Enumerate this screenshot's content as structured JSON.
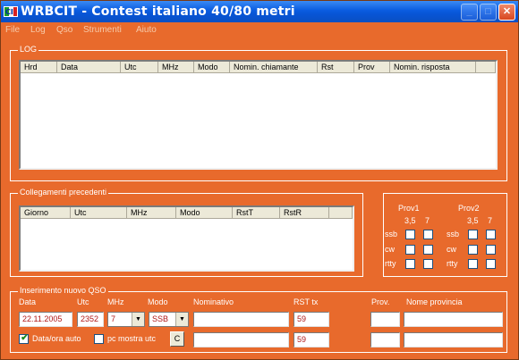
{
  "window": {
    "title": "WRBCIT - Contest italiano 40/80 metri",
    "minimize": "_",
    "maximize": "□",
    "close": "✕",
    "icon": "app-icon"
  },
  "menu": [
    "File",
    "Log",
    "Qso",
    "Strumenti",
    "Aiuto"
  ],
  "log": {
    "label": "LOG",
    "columns": [
      "Hrd",
      "Data",
      "Utc",
      "MHz",
      "Modo",
      "Nomin. chiamante",
      "Rst",
      "Prov",
      "Nomin. risposta"
    ]
  },
  "previous": {
    "label": "Collegamenti precedenti",
    "columns": [
      "Giorno",
      "Utc",
      "MHz",
      "Modo",
      "RstT",
      "RstR"
    ]
  },
  "prov": {
    "prov1": "Prov1",
    "prov2": "Prov2",
    "band1": "3,5",
    "band2": "7",
    "modes": [
      "ssb",
      "cw",
      "rtty"
    ]
  },
  "newqso": {
    "label": "Inserimento nuovo QSO",
    "data_label": "Data",
    "utc_label": "Utc",
    "mhz_label": "MHz",
    "modo_label": "Modo",
    "nominativo_label": "Nominativo",
    "rst_label": "RST tx",
    "prov_label": "Prov.",
    "nome_prov_label": "Nome provincia",
    "data_value": "22.11.2005",
    "utc_value": "2352",
    "mhz_value": "7",
    "modo_value": "SSB",
    "rst_value": "59",
    "rst_value2": "59",
    "dataora_auto_label": "Data/ora auto",
    "dataora_auto_checked": true,
    "pc_mostra_label": "pc mostra utc",
    "pc_mostra_checked": false,
    "c_button": "C"
  }
}
